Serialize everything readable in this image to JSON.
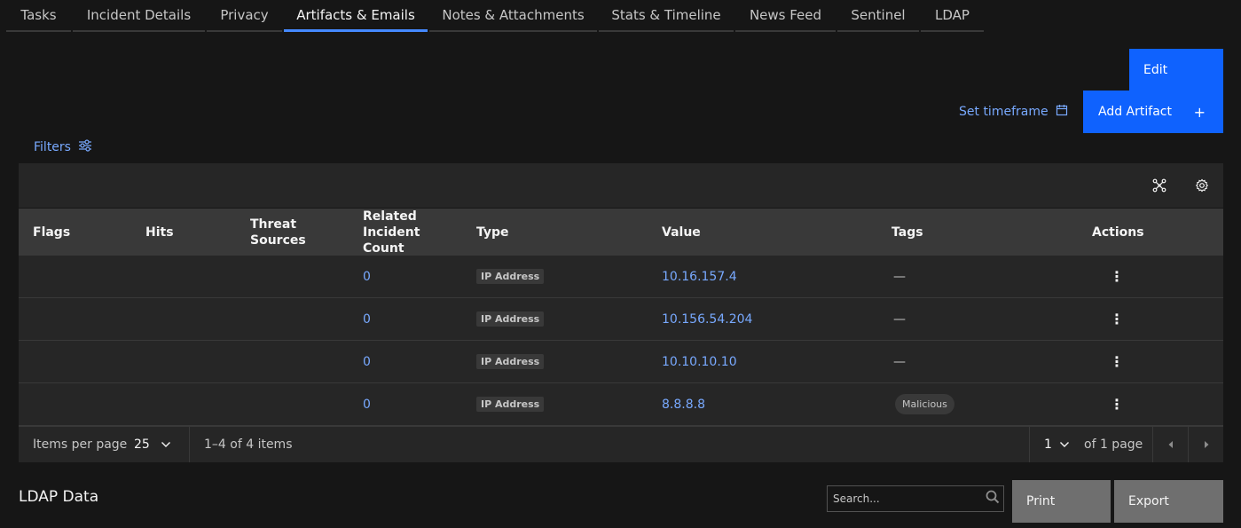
{
  "tabs": [
    {
      "label": "Tasks"
    },
    {
      "label": "Incident Details"
    },
    {
      "label": "Privacy"
    },
    {
      "label": "Artifacts & Emails",
      "active": true
    },
    {
      "label": "Notes & Attachments"
    },
    {
      "label": "Stats & Timeline"
    },
    {
      "label": "News Feed"
    },
    {
      "label": "Sentinel"
    },
    {
      "label": "LDAP"
    }
  ],
  "actions": {
    "edit_label": "Edit",
    "add_artifact_label": "Add Artifact",
    "add_icon": "plus-icon",
    "set_timeframe_label": "Set timeframe",
    "timeframe_icon": "calendar-icon",
    "filters_label": "Filters",
    "filters_icon": "sliders-icon"
  },
  "toolbar": {
    "icons": [
      "graph-network-icon",
      "settings-gear-icon"
    ]
  },
  "table": {
    "headers": {
      "flags": "Flags",
      "hits": "Hits",
      "threat_sources": "Threat Sources",
      "related_count": "Related Incident Count",
      "type": "Type",
      "value": "Value",
      "tags": "Tags",
      "actions": "Actions"
    },
    "rows": [
      {
        "related_count": "0",
        "type": "IP Address",
        "value": "10.16.157.4",
        "tags": "—"
      },
      {
        "related_count": "0",
        "type": "IP Address",
        "value": "10.156.54.204",
        "tags": "—"
      },
      {
        "related_count": "0",
        "type": "IP Address",
        "value": "10.10.10.10",
        "tags": "—"
      },
      {
        "related_count": "0",
        "type": "IP Address",
        "value": "8.8.8.8",
        "tags": "Malicious"
      }
    ],
    "row_action_icon": "overflow-menu-vertical-icon"
  },
  "pagination": {
    "items_per_page_label": "Items per page",
    "items_per_page_value": "25",
    "range_text": "1–4 of 4 items",
    "page_value": "1",
    "page_total_text": "of 1 page"
  },
  "ldap": {
    "title": "LDAP Data",
    "search_placeholder": "Search...",
    "print_label": "Print",
    "export_label": "Export"
  },
  "colors": {
    "background": "#161616",
    "surface": "#262626",
    "header": "#393939",
    "accent": "#0f62fe",
    "link": "#78a9ff",
    "secondary_button": "#6f6f6f"
  }
}
